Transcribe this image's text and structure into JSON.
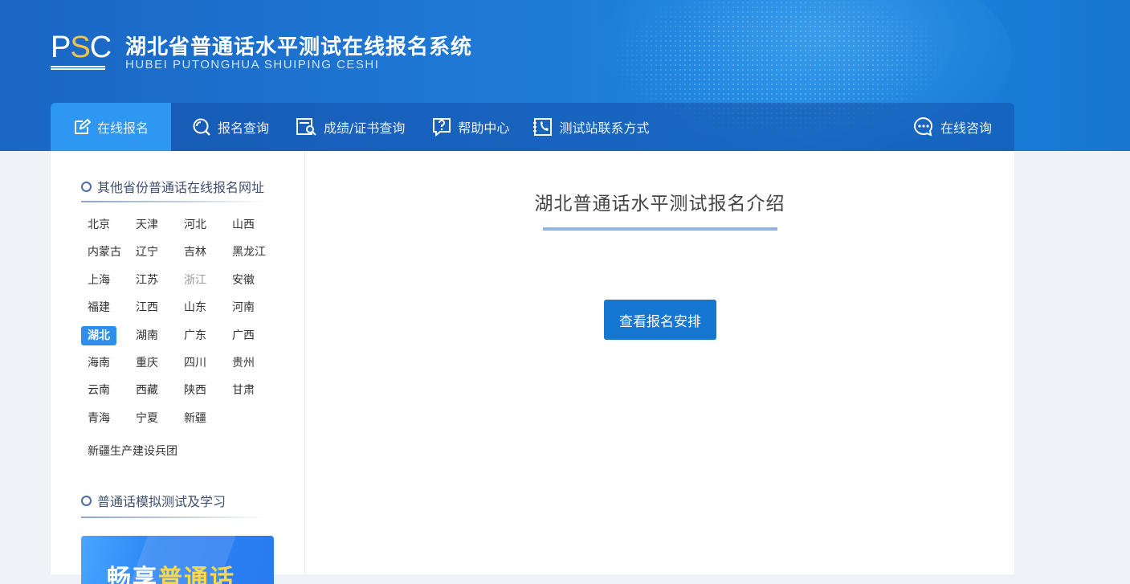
{
  "header": {
    "logo_text_p": "P",
    "logo_text_s": "S",
    "logo_text_c": "C",
    "title": "湖北省普通话水平测试在线报名系统",
    "subtitle": "HUBEI PUTONGHUA SHUIPING CESHI"
  },
  "nav": {
    "items": [
      {
        "label": "在线报名",
        "icon": "edit-icon"
      },
      {
        "label": "报名查询",
        "icon": "search-circle-icon"
      },
      {
        "label": "成绩/证书查询",
        "icon": "certificate-search-icon"
      },
      {
        "label": "帮助中心",
        "icon": "help-icon"
      },
      {
        "label": "测试站联系方式",
        "icon": "phone-book-icon"
      }
    ],
    "consult": {
      "label": "在线咨询",
      "icon": "chat-icon"
    }
  },
  "sidebar": {
    "provinces_title": "其他省份普通话在线报名网址",
    "provinces": [
      [
        "北京",
        "天津",
        "河北",
        "山西"
      ],
      [
        "内蒙古",
        "辽宁",
        "吉林",
        "黑龙江"
      ],
      [
        "上海",
        "江苏",
        "浙江",
        "安徽"
      ],
      [
        "福建",
        "江西",
        "山东",
        "河南"
      ],
      [
        "湖北",
        "湖南",
        "广东",
        "广西"
      ],
      [
        "海南",
        "重庆",
        "四川",
        "贵州"
      ],
      [
        "云南",
        "西藏",
        "陕西",
        "甘肃"
      ],
      [
        "青海",
        "宁夏",
        "新疆"
      ]
    ],
    "corps": "新疆生产建设兵团",
    "active_province": "湖北",
    "dim_province": "浙江",
    "study_title": "普通话模拟测试及学习",
    "banner_part1": "畅享",
    "banner_part2": "普通话"
  },
  "main": {
    "title": "湖北普通话水平测试报名介绍",
    "button": "查看报名安排"
  },
  "colors": {
    "header_blue": "#1f7ad6",
    "nav_active": "#2d97f2",
    "button_blue": "#1677d2",
    "province_active": "#2d8ef0"
  }
}
